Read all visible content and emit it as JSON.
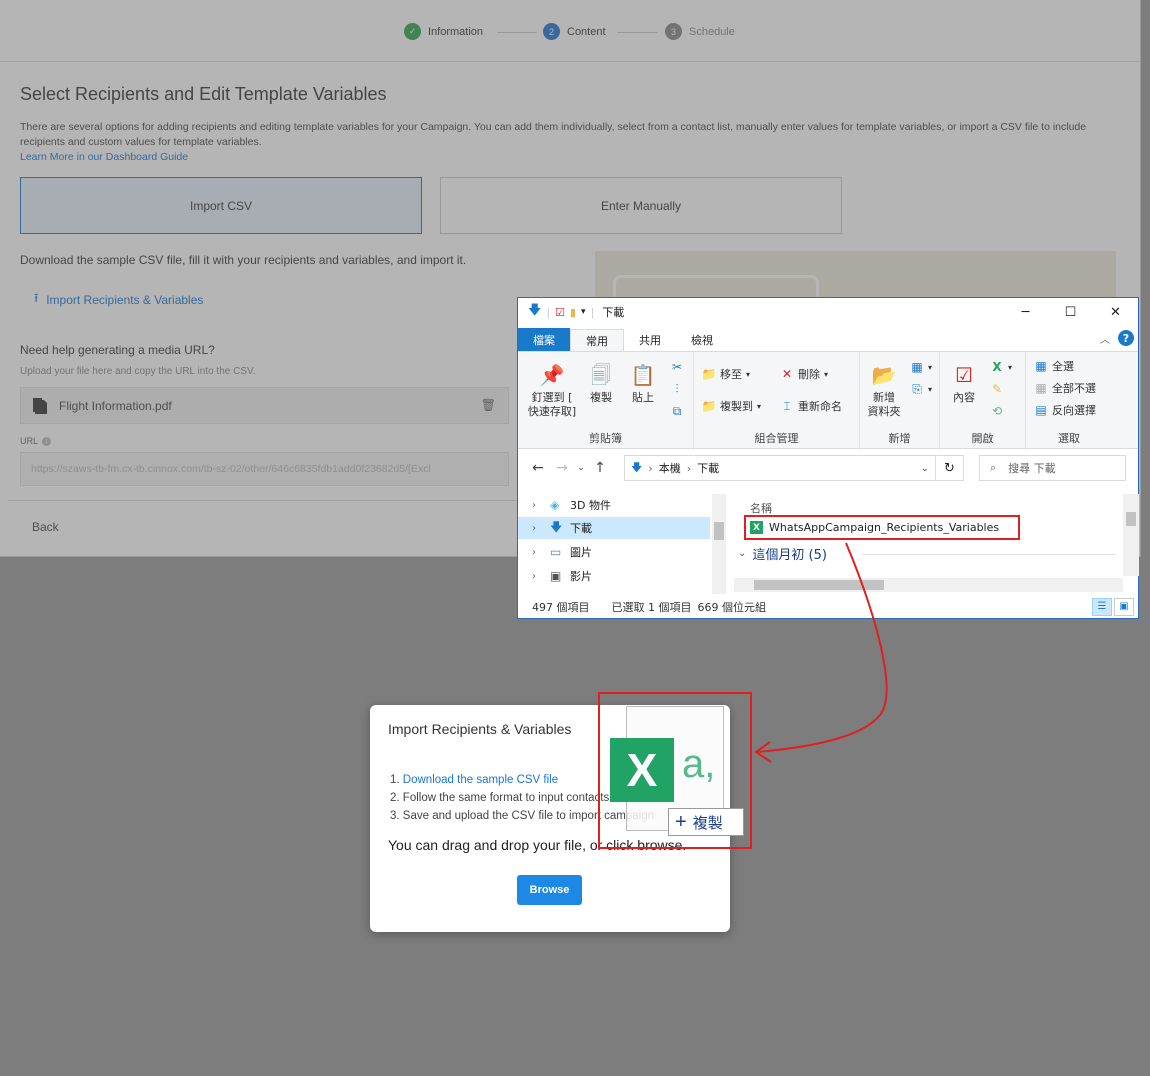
{
  "stepper": {
    "steps": [
      {
        "num": "✓",
        "label": "Information"
      },
      {
        "num": "2",
        "label": "Content"
      },
      {
        "num": "3",
        "label": "Schedule"
      }
    ]
  },
  "page": {
    "title": "Select Recipients and Edit Template Variables",
    "description": "There are several options for adding recipients and editing template variables for your Campaign. You can add them individually, select from a contact list, manually enter values for template variables, or import a CSV file to include recipients and custom values for template variables.",
    "guide_link": "Learn More in our Dashboard Guide",
    "tabs": {
      "csv": "Import CSV",
      "manual": "Enter Manually"
    },
    "download_text": "Download the sample CSV file, fill it with your recipients and variables, and import it.",
    "import_link": "Import Recipients & Variables",
    "media_question": "Need help generating a media URL?",
    "media_hint": "Upload your file here and copy the URL into the CSV.",
    "file_name": "Flight Information.pdf",
    "url_label": "URL",
    "url_value": "https://szaws-tb-fm.cx-tb.cinnox.com/tb-sz-02/other/646c6835fdb1add0f23682d5/[Excl",
    "back": "Back"
  },
  "modal": {
    "title": "Import Recipients & Variables",
    "step1": "Download the sample CSV file",
    "step2": "Follow the same format to input contacts",
    "step3": "Save and upload the CSV file to import campaign",
    "drop_text": "You can drag and drop your file, or click browse.",
    "browse": "Browse"
  },
  "drag_ghost": {
    "excel_letter": "X",
    "excel_sub": "a,",
    "copy_label": "複製"
  },
  "explorer": {
    "title": "下載",
    "window_buttons": {
      "minimize": "─",
      "maximize": "☐",
      "close": "✕"
    },
    "tabs": {
      "file": "檔案",
      "home": "常用",
      "share": "共用",
      "view": "檢視"
    },
    "ribbon": {
      "pin": "釘選到 [\n快速存取]",
      "copy": "複製",
      "paste": "貼上",
      "move_to": "移至",
      "copy_to": "複製到",
      "delete": "刪除",
      "rename": "重新命名",
      "new_folder": "新增\n資料夾",
      "properties": "內容",
      "select_all": "全選",
      "select_none": "全部不選",
      "invert_selection": "反向選擇",
      "groups": {
        "clipboard": "剪貼簿",
        "organize": "組合管理",
        "new": "新增",
        "open": "開啟",
        "select": "選取"
      }
    },
    "address": {
      "root": "本機",
      "current": "下載",
      "search_placeholder": "搜尋 下載"
    },
    "nav": [
      {
        "label": "3D 物件",
        "icon": "3d-objects-icon"
      },
      {
        "label": "下載",
        "icon": "download-folder-icon"
      },
      {
        "label": "圖片",
        "icon": "pictures-icon"
      },
      {
        "label": "影片",
        "icon": "videos-icon"
      }
    ],
    "list": {
      "column_name": "名稱",
      "selected_file": "WhatsAppCampaign_Recipients_Variables",
      "group_label": "這個月初 (5)"
    },
    "status": {
      "count": "497 個項目",
      "selected": "已選取 1 個項目",
      "size": "669 個位元組"
    }
  },
  "colors": {
    "accent": "#1976d2",
    "success": "#2ea44f",
    "excel": "#21a366",
    "highlight": "#e02020"
  }
}
